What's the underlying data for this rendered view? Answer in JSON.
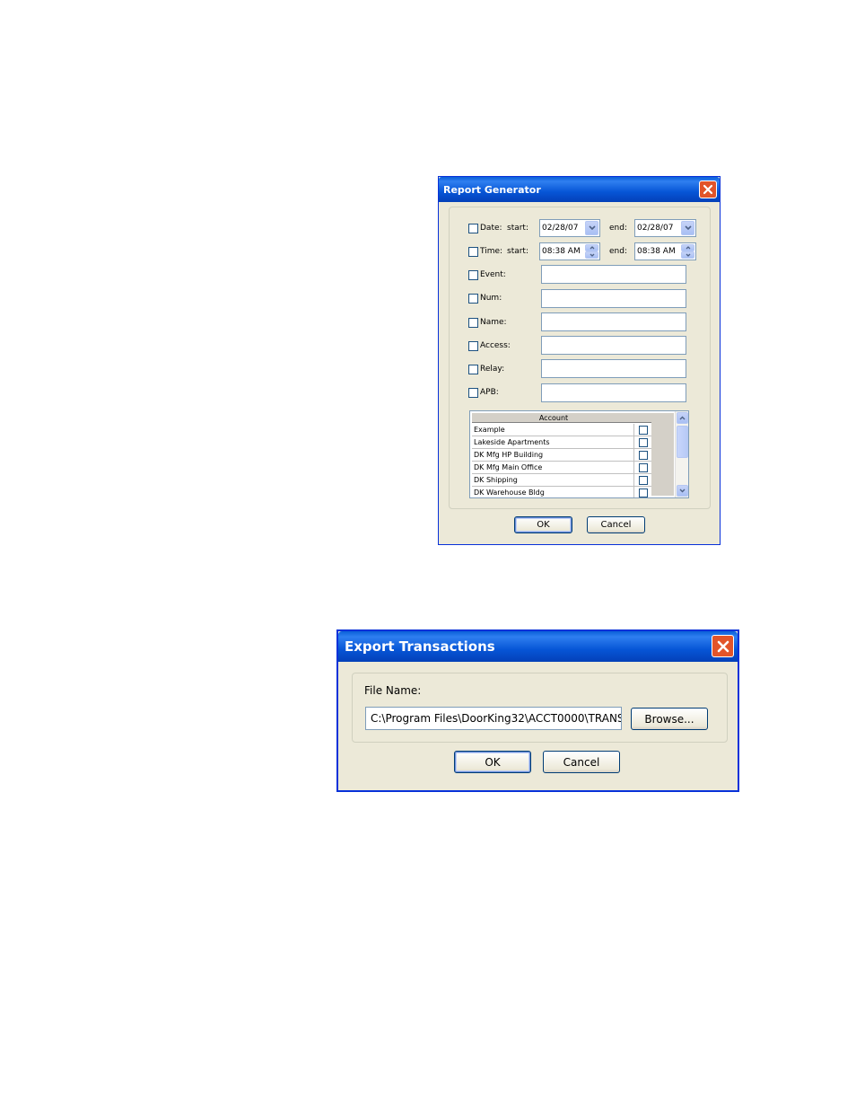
{
  "report_dialog": {
    "title": "Report Generator",
    "rows": [
      {
        "label": "Date:",
        "start_label": "start:",
        "start_value": "02/28/07",
        "end_label": "end:",
        "end_value": "02/28/07"
      },
      {
        "label": "Time:",
        "start_label": "start:",
        "start_value": "08:38 AM",
        "end_label": "end:",
        "end_value": "08:38 AM"
      }
    ],
    "fields": [
      {
        "label": "Event:",
        "value": ""
      },
      {
        "label": "Num:",
        "value": ""
      },
      {
        "label": "Name:",
        "value": ""
      },
      {
        "label": "Access:",
        "value": ""
      },
      {
        "label": "Relay:",
        "value": ""
      },
      {
        "label": "APB:",
        "value": ""
      }
    ],
    "account_grid": {
      "header": "Account",
      "rows": [
        "Example",
        "Lakeside Apartments",
        "DK Mfg HP Building",
        "DK Mfg Main Office",
        "DK Shipping",
        "DK Warehouse Bldg"
      ]
    },
    "ok_label": "OK",
    "cancel_label": "Cancel"
  },
  "export_dialog": {
    "title": "Export Transactions",
    "file_name_label": "File Name:",
    "file_name_value": "C:\\Program Files\\DoorKing32\\ACCT0000\\TRANS",
    "browse_label": "Browse...",
    "ok_label": "OK",
    "cancel_label": "Cancel"
  },
  "colors": {
    "title_bar": "#0655d6",
    "close_button": "#e2542a",
    "dialog_face": "#ece9d8"
  }
}
